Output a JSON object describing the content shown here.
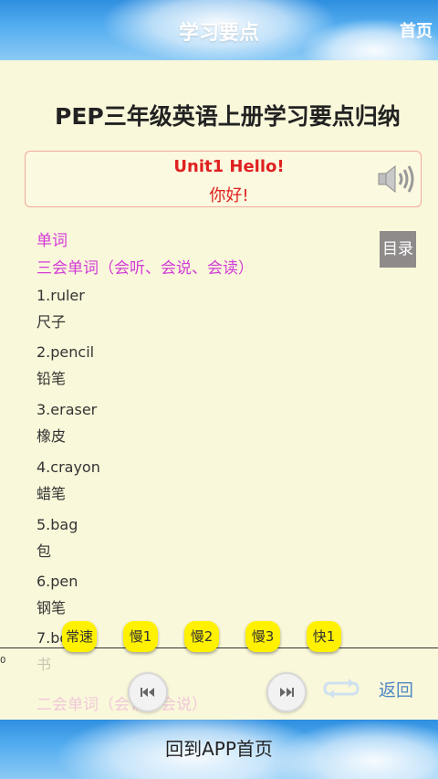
{
  "header": {
    "title": "学习要点",
    "home_label": "首页"
  },
  "page_title": "PEP三年级英语上册学习要点归纳",
  "unit": {
    "title_en": "Unit1 Hello!",
    "title_zh": "你好!",
    "audio_icon": "speaker-icon"
  },
  "section": {
    "heading": "单词",
    "subheading": "三会单词（会听、会说、会读）",
    "next_heading": "二会单词（会认、会说）"
  },
  "toc_label": "目录",
  "words": [
    {
      "en": "1.ruler",
      "zh": "尺子"
    },
    {
      "en": "2.pencil",
      "zh": "铅笔"
    },
    {
      "en": "3.eraser",
      "zh": "橡皮"
    },
    {
      "en": "4.crayon",
      "zh": "蜡笔"
    },
    {
      "en": "5.bag",
      "zh": "包"
    },
    {
      "en": "6.pen",
      "zh": "钢笔"
    },
    {
      "en": "7.book",
      "zh": "书"
    }
  ],
  "player": {
    "time_label": "0",
    "speeds": [
      "常速",
      "慢1",
      "慢2",
      "慢3",
      "快1"
    ],
    "prev_icon": "skip-previous-icon",
    "next_icon": "skip-next-icon",
    "repeat_icon": "repeat-icon",
    "back_label": "返回"
  },
  "footer": {
    "label": "回到APP首页"
  }
}
